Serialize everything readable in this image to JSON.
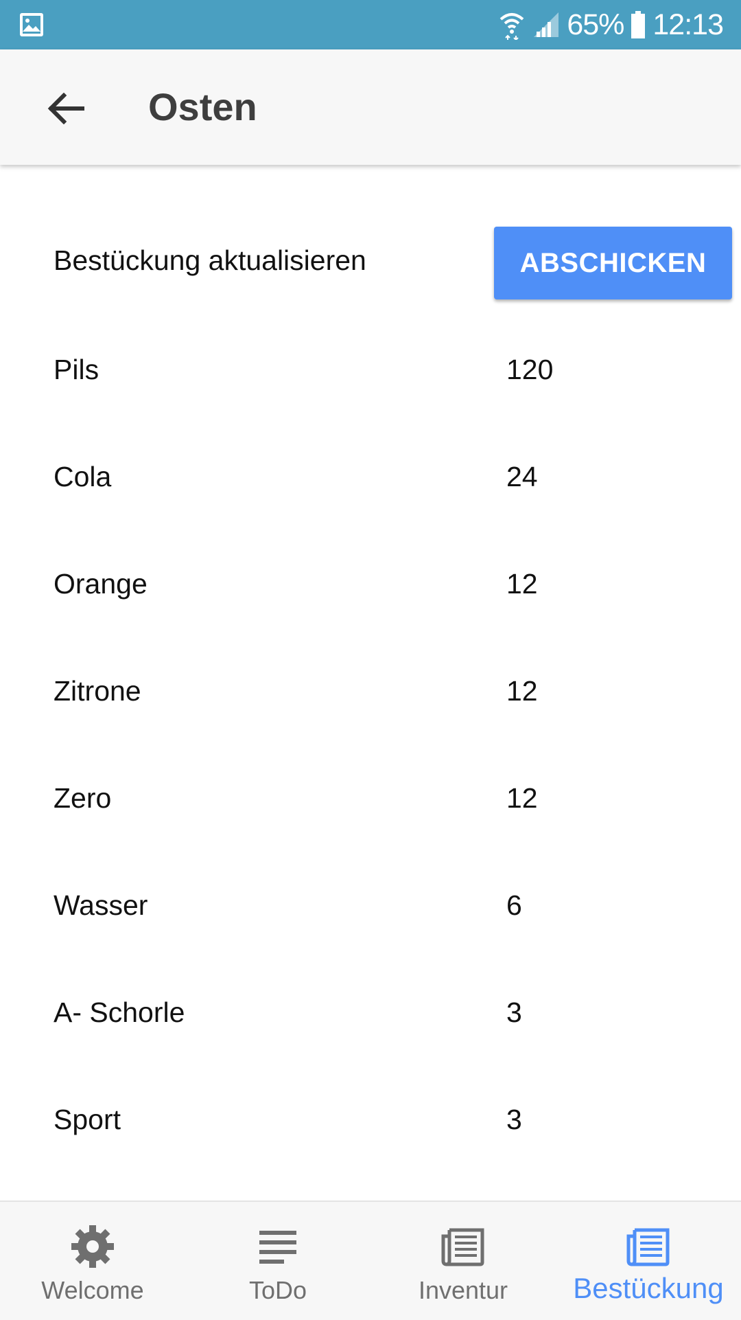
{
  "status_bar": {
    "battery_percent": "65%",
    "time": "12:13",
    "icons": [
      "gallery-icon",
      "wifi-icon",
      "signal-icon",
      "battery-icon"
    ]
  },
  "app_bar": {
    "title": "Osten",
    "back_icon": "arrow-left-icon"
  },
  "update_section": {
    "label": "Bestückung aktualisieren",
    "button_label": "ABSCHICKEN"
  },
  "items": [
    {
      "name": "Pils",
      "qty": "120"
    },
    {
      "name": "Cola",
      "qty": "24"
    },
    {
      "name": "Orange",
      "qty": "12"
    },
    {
      "name": "Zitrone",
      "qty": "12"
    },
    {
      "name": "Zero",
      "qty": "12"
    },
    {
      "name": "Wasser",
      "qty": "6"
    },
    {
      "name": "A- Schorle",
      "qty": "3"
    },
    {
      "name": "Sport",
      "qty": "3"
    }
  ],
  "bottom_nav": [
    {
      "label": "Welcome",
      "icon": "gear-icon",
      "active": false
    },
    {
      "label": "ToDo",
      "icon": "list-icon",
      "active": false
    },
    {
      "label": "Inventur",
      "icon": "newspaper-icon",
      "active": false
    },
    {
      "label": "Bestückung",
      "icon": "newspaper-icon",
      "active": true
    }
  ],
  "colors": {
    "status_bar": "#4a9fc1",
    "accent": "#4f8ff7",
    "app_bar_bg": "#f7f7f7",
    "inactive_nav": "#6f6f6f"
  }
}
